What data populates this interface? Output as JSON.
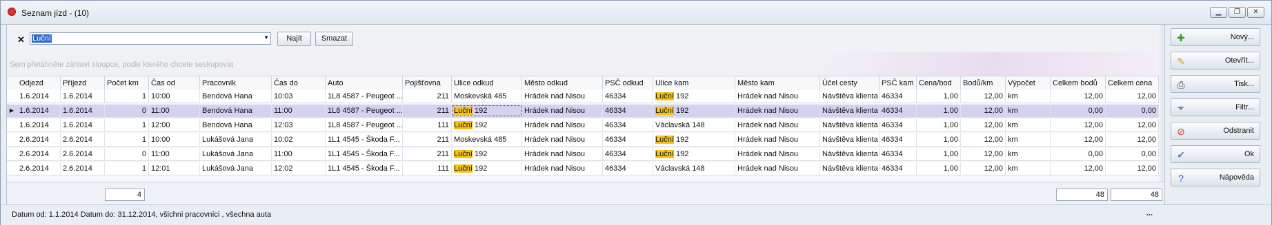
{
  "window": {
    "title": "Seznam jízd - (10)",
    "minimize": "▁",
    "restore": "❐",
    "close": "✕"
  },
  "filter": {
    "clear_icon": "✕",
    "value": "Luční",
    "arrow": "▼",
    "find_label": "Najít",
    "delete_label": "Smazat"
  },
  "group_hint": "Sem přetáhněte záhlaví sloupce, podle kterého chcete seskupovat",
  "columns": [
    "Odjezd",
    "Příjezd",
    "Počet km",
    "Čas od",
    "Pracovník",
    "Čas do",
    "Auto",
    "Pojišťovna",
    "Ulice odkud",
    "Město odkud",
    "PSČ odkud",
    "Ulice kam",
    "Město kam",
    "Účel cesty",
    "PSČ kam",
    "Cena/bod",
    "Bodů/km",
    "Výpočet",
    "Celkem bodů",
    "Celkem cena"
  ],
  "rows": [
    [
      "1.6.2014",
      "1.6.2014",
      "1",
      "10:00",
      "Bendová Hana",
      "10:03",
      "1L8 4587 - Peugeot ...",
      "211",
      "Moskevská 485",
      "Hrádek nad Nisou",
      "46334",
      "Luční 192",
      "Hrádek nad Nisou",
      "Návštěva klienta",
      "46334",
      "1,00",
      "12,00",
      "km",
      "12,00",
      "12,00"
    ],
    [
      "1.6.2014",
      "1.6.2014",
      "0",
      "11:00",
      "Bendová Hana",
      "11:00",
      "1L8 4587 - Peugeot ...",
      "211",
      "Luční 192",
      "Hrádek nad Nisou",
      "46334",
      "Luční 192",
      "Hrádek nad Nisou",
      "Návštěva klienta",
      "46334",
      "1,00",
      "12,00",
      "km",
      "0,00",
      "0,00"
    ],
    [
      "1.6.2014",
      "1.6.2014",
      "1",
      "12:00",
      "Bendová Hana",
      "12:03",
      "1L8 4587 - Peugeot ...",
      "111",
      "Luční 192",
      "Hrádek nad Nisou",
      "46334",
      "Václavská 148",
      "Hrádek nad Nisou",
      "Návštěva klienta",
      "46334",
      "1,00",
      "12,00",
      "km",
      "12,00",
      "12,00"
    ],
    [
      "2.6.2014",
      "2.6.2014",
      "1",
      "10:00",
      "Lukášová Jana",
      "10:02",
      "1L1 4545 - Škoda F...",
      "211",
      "Moskevská 485",
      "Hrádek nad Nisou",
      "46334",
      "Luční 192",
      "Hrádek nad Nisou",
      "Návštěva klienta",
      "46334",
      "1,00",
      "12,00",
      "km",
      "12,00",
      "12,00"
    ],
    [
      "2.6.2014",
      "2.6.2014",
      "0",
      "11:00",
      "Lukášová Jana",
      "11:00",
      "1L1 4545 - Škoda F...",
      "211",
      "Luční 192",
      "Hrádek nad Nisou",
      "46334",
      "Luční 192",
      "Hrádek nad Nisou",
      "Návštěva klienta",
      "46334",
      "1,00",
      "12,00",
      "km",
      "0,00",
      "0,00"
    ],
    [
      "2.6.2014",
      "2.6.2014",
      "1",
      "12:01",
      "Lukášová Jana",
      "12:02",
      "1L1 4545 - Škoda F...",
      "111",
      "Luční 192",
      "Hrádek nad Nisou",
      "46334",
      "Václavská 148",
      "Hrádek nad Nisou",
      "Návštěva klienta",
      "46334",
      "1,00",
      "12,00",
      "km",
      "12,00",
      "12,00"
    ]
  ],
  "selected_row": 1,
  "row_indicator": "▶",
  "highlight_term": "Luční",
  "totals": {
    "km": "4",
    "celkem_bodu": "48",
    "celkem_cena": "48"
  },
  "side_buttons": [
    {
      "label": "Nový...",
      "icon": "plus-icon",
      "glyph": "✚",
      "color": "#3a9a2a"
    },
    {
      "label": "Otevřít...",
      "icon": "pencil-icon",
      "glyph": "✎",
      "color": "#d6a21a"
    },
    {
      "label": "Tisk...",
      "icon": "printer-icon",
      "glyph": "⎙",
      "color": "#444444"
    },
    {
      "label": "Filtr...",
      "icon": "funnel-icon",
      "glyph": "⏷",
      "color": "#888888"
    },
    {
      "label": "Odstranit",
      "icon": "delete-icon",
      "glyph": "⊘",
      "color": "#d23b2a"
    },
    {
      "label": "Ok",
      "icon": "check-icon",
      "glyph": "✔",
      "color": "#5a7fb0"
    },
    {
      "label": "Nápověda",
      "icon": "help-icon",
      "glyph": "?",
      "color": "#2a66c0"
    }
  ],
  "status": {
    "text": "Datum od: 1.1.2014 Datum do: 31.12.2014, všichni pracovníci , všechna auta",
    "more": "..."
  },
  "colors": {
    "selected_row": "#d3d3f0",
    "highlight": "#f6c31a"
  }
}
